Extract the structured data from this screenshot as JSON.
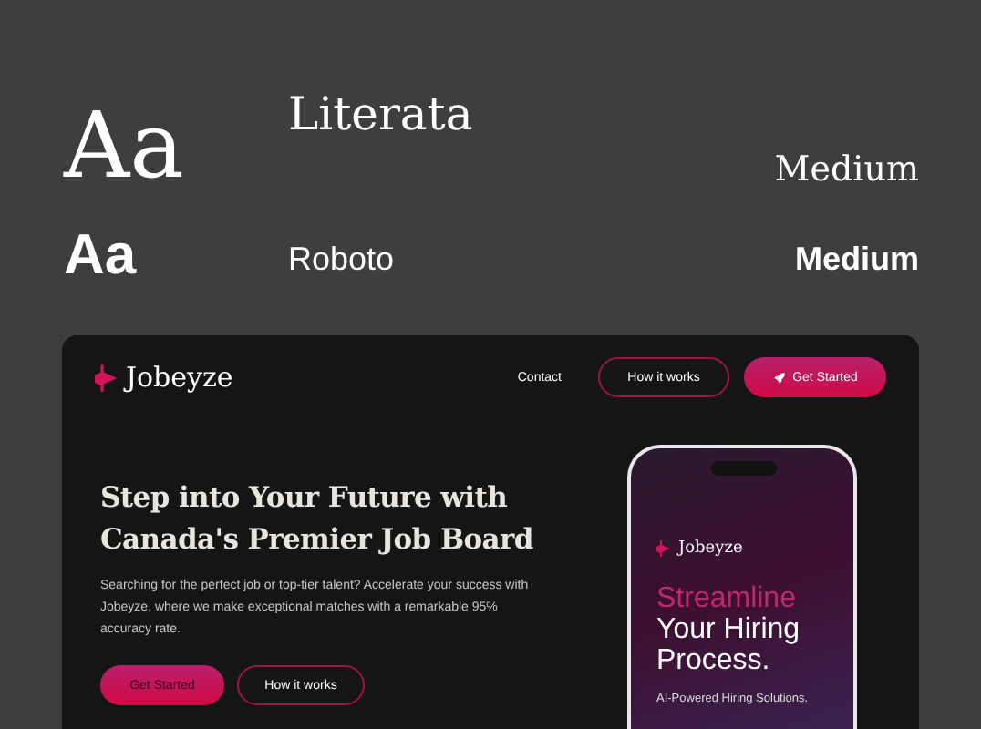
{
  "specimens": [
    {
      "kind": "serif",
      "sample": "Aa",
      "family": "Literata",
      "weight": "Medium"
    },
    {
      "kind": "sans",
      "sample": "Aa",
      "family": "Roboto",
      "weight": "Medium"
    }
  ],
  "site": {
    "logo": "Jobeyze",
    "nav": [
      {
        "kind": "link",
        "label": "Contact"
      },
      {
        "kind": "outline",
        "label": "How it works"
      },
      {
        "kind": "primary",
        "label": "Get Started"
      }
    ],
    "hero": {
      "heading": "Step into Your Future with Canada's Premier Job Board",
      "text": "Searching for the perfect job or top-tier talent?   Accelerate your success with Jobeyze, where we make exceptional matches with a remarkable 95% accuracy rate.",
      "buttons": [
        {
          "kind": "primary",
          "label": "Get Started"
        },
        {
          "kind": "outline",
          "label": "How it works"
        }
      ]
    },
    "phone": {
      "logo": "Jobeyze",
      "accent": "Streamline",
      "headline": "Your Hiring Process.",
      "tagline": "AI-Powered Hiring Solutions."
    }
  }
}
